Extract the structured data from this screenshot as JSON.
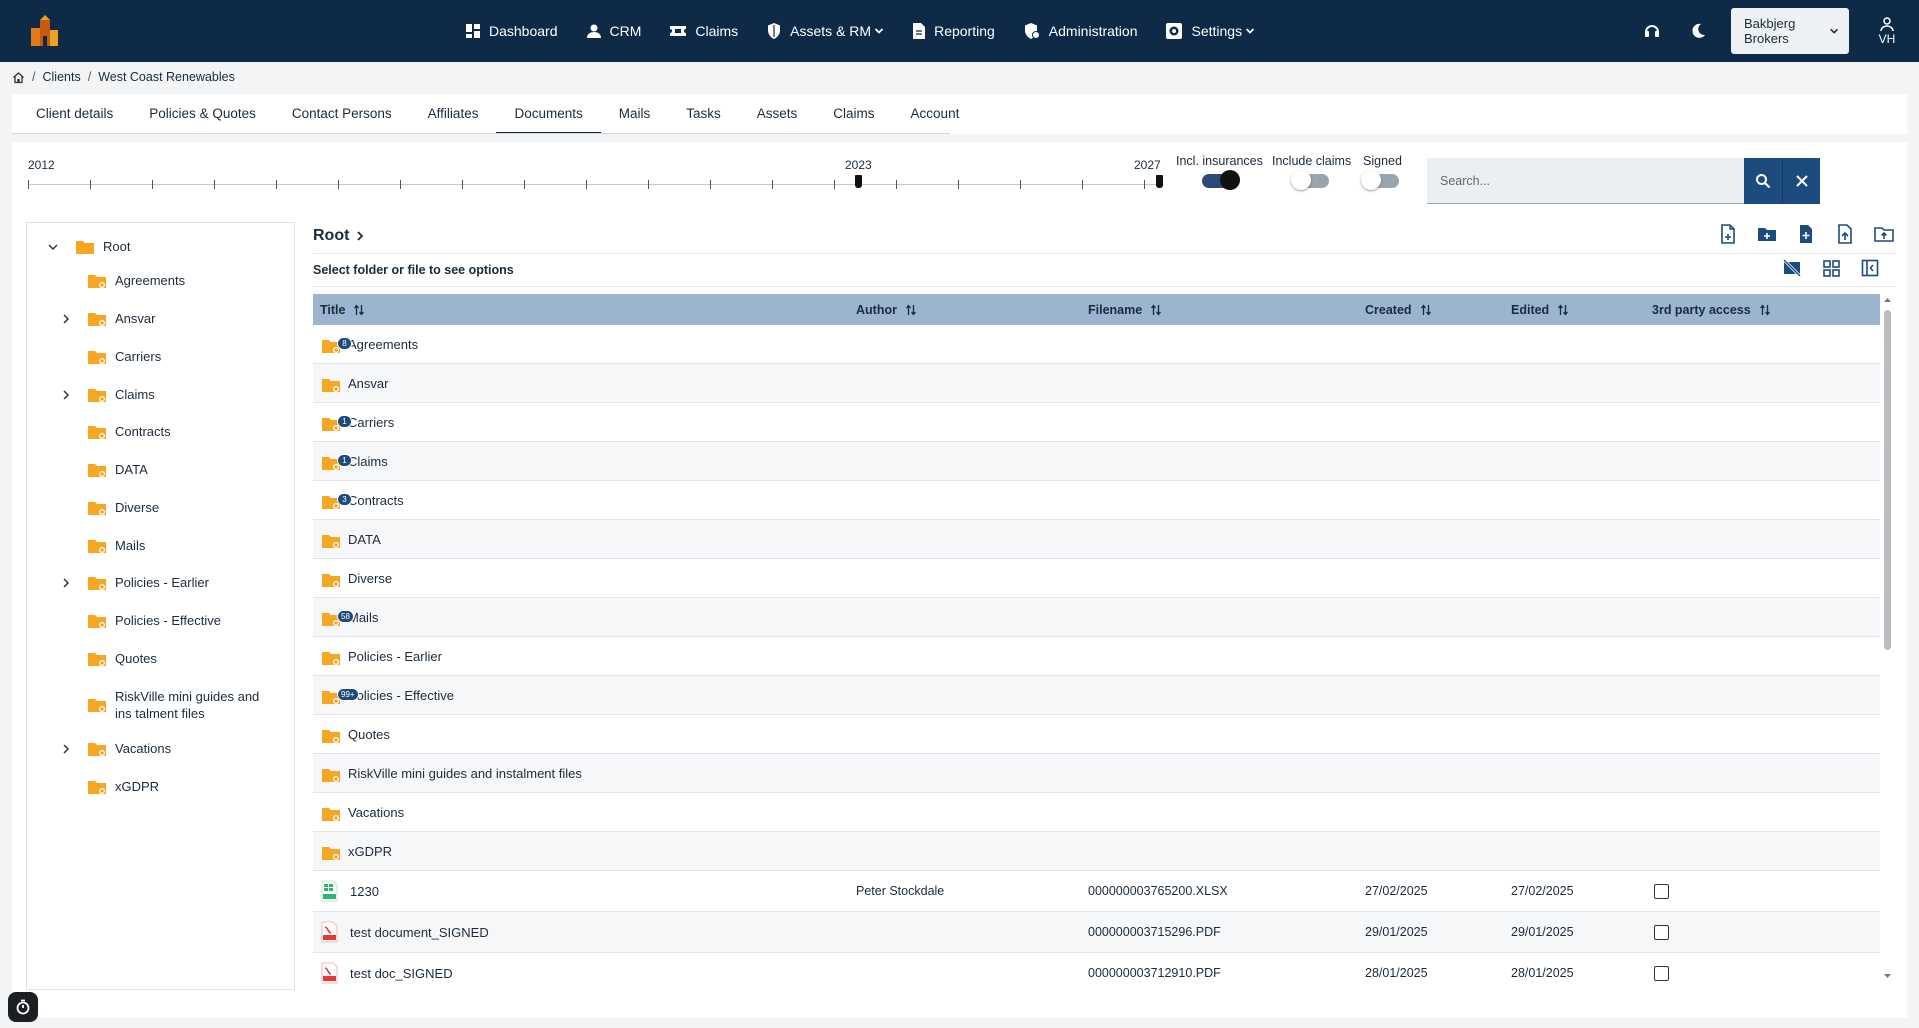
{
  "topnav": {
    "items": [
      {
        "label": "Dashboard",
        "icon": "dashboard-icon"
      },
      {
        "label": "CRM",
        "icon": "person-icon"
      },
      {
        "label": "Claims",
        "icon": "ticket-icon"
      },
      {
        "label": "Assets & RM",
        "icon": "shield-icon",
        "dropdown": true
      },
      {
        "label": "Reporting",
        "icon": "document-icon"
      },
      {
        "label": "Administration",
        "icon": "admin-shield-icon"
      },
      {
        "label": "Settings",
        "icon": "gear-icon",
        "dropdown": true
      }
    ],
    "company": "Bakbjerg Brokers",
    "user_initials": "VH"
  },
  "breadcrumb": [
    "Clients",
    "West Coast Renewables"
  ],
  "tabs": [
    "Client details",
    "Policies & Quotes",
    "Contact Persons",
    "Affiliates",
    "Documents",
    "Mails",
    "Tasks",
    "Assets",
    "Claims",
    "Account"
  ],
  "active_tab": "Documents",
  "timeline": {
    "start_label": "2012",
    "mid_label": "2023",
    "end_label": "2027"
  },
  "toggles": [
    {
      "label": "Incl. insurances",
      "on": true
    },
    {
      "label": "Include claims",
      "on": false
    },
    {
      "label": "Signed",
      "on": false
    }
  ],
  "search": {
    "placeholder": "Search..."
  },
  "tree": {
    "root": "Root",
    "items": [
      {
        "label": "Agreements",
        "expandable": false
      },
      {
        "label": "Ansvar",
        "expandable": true
      },
      {
        "label": "Carriers",
        "expandable": false
      },
      {
        "label": "Claims",
        "expandable": true
      },
      {
        "label": "Contracts",
        "expandable": false
      },
      {
        "label": "DATA",
        "expandable": false
      },
      {
        "label": "Diverse",
        "expandable": false
      },
      {
        "label": "Mails",
        "expandable": false
      },
      {
        "label": "Policies - Earlier",
        "expandable": true
      },
      {
        "label": "Policies - Effective",
        "expandable": false
      },
      {
        "label": "Quotes",
        "expandable": false
      },
      {
        "label": "RiskVille mini guides and ins talment files",
        "expandable": false
      },
      {
        "label": "Vacations",
        "expandable": true
      },
      {
        "label": "xGDPR",
        "expandable": false
      }
    ]
  },
  "content": {
    "title": "Root",
    "hint": "Select folder or file to see options"
  },
  "table": {
    "columns": [
      "Title",
      "Author",
      "Filename",
      "Created",
      "Edited",
      "3rd party access"
    ],
    "folders": [
      {
        "title": "Agreements",
        "badge": "8"
      },
      {
        "title": "Ansvar",
        "badge": ""
      },
      {
        "title": "Carriers",
        "badge": "1"
      },
      {
        "title": "Claims",
        "badge": "1"
      },
      {
        "title": "Contracts",
        "badge": "3"
      },
      {
        "title": "DATA",
        "badge": ""
      },
      {
        "title": "Diverse",
        "badge": ""
      },
      {
        "title": "Mails",
        "badge": "58"
      },
      {
        "title": "Policies - Earlier",
        "badge": ""
      },
      {
        "title": "Policies - Effective",
        "badge": "99+"
      },
      {
        "title": "Quotes",
        "badge": ""
      },
      {
        "title": "RiskVille mini guides and instalment files",
        "badge": ""
      },
      {
        "title": "Vacations",
        "badge": ""
      },
      {
        "title": "xGDPR",
        "badge": ""
      }
    ],
    "files": [
      {
        "title": "1230",
        "type": "xlsx",
        "author": "Peter Stockdale",
        "filename": "000000003765200.XLSX",
        "created": "27/02/2025",
        "edited": "27/02/2025",
        "third_party": false
      },
      {
        "title": "test document_SIGNED",
        "type": "pdf",
        "author": "",
        "filename": "000000003715296.PDF",
        "created": "29/01/2025",
        "edited": "29/01/2025",
        "third_party": false
      },
      {
        "title": "test doc_SIGNED",
        "type": "pdf",
        "author": "",
        "filename": "000000003712910.PDF",
        "created": "28/01/2025",
        "edited": "28/01/2025",
        "third_party": false
      }
    ]
  },
  "colors": {
    "navbar": "#0f2a47",
    "folder": "#f5a623",
    "table_header": "#9bb4d0",
    "accent": "#1e4b7d"
  }
}
